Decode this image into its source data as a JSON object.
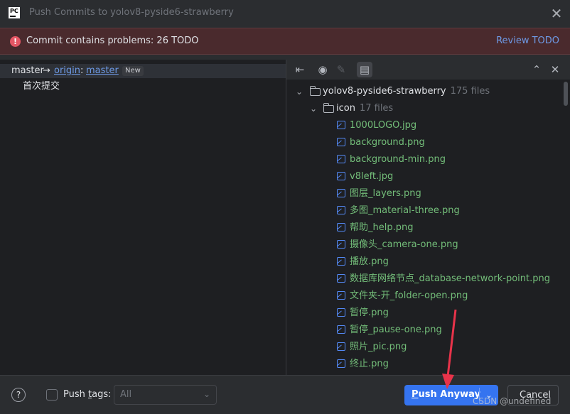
{
  "window": {
    "title": "Push Commits to yolov8-pyside6-strawberry",
    "logo": "PC"
  },
  "banner": {
    "message": "Commit contains problems: 26 TODO",
    "link": "Review TODO",
    "error_color": "#e55765"
  },
  "commits": {
    "local_branch": "master",
    "arrow": "→",
    "remote": "origin",
    "separator": ":",
    "remote_branch": "master",
    "badge": "New",
    "message": "首次提交"
  },
  "tree": {
    "root": {
      "name": "yolov8-pyside6-strawberry",
      "count": "175 files"
    },
    "folder": {
      "name": "icon",
      "count": "17 files"
    },
    "files": [
      "1000LOGO.jpg",
      "background.png",
      "background-min.png",
      "v8left.jpg",
      "图层_layers.png",
      "多图_material-three.png",
      "帮助_help.png",
      "摄像头_camera-one.png",
      "播放.png",
      "数据库网络节点_database-network-point.png",
      "文件夹-开_folder-open.png",
      "暂停.png",
      "暂停_pause-one.png",
      "照片_pic.png",
      "终止.png"
    ]
  },
  "footer": {
    "help": "?",
    "push_tags_label_pre": "Push ",
    "push_tags_label_mnemonic": "t",
    "push_tags_label_post": "ags:",
    "tags_value": "All",
    "push_pre": "",
    "push_mnemonic": "P",
    "push_post": "ush Anyway",
    "cancel": "Cancel"
  },
  "watermark": "CSDN @undefined",
  "accent_color": "#3574f0"
}
